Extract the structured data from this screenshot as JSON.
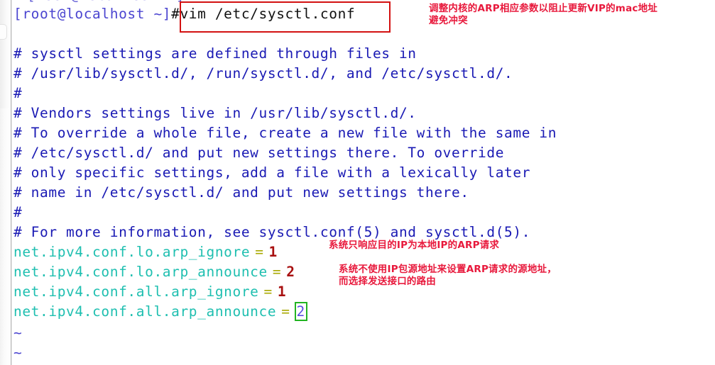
{
  "terminal": {
    "prompt": "[root@localhost ~]",
    "command": "#vim /etc/sysctl.conf",
    "top_partial_line": "[root@localhost ~]#",
    "comments": [
      "# sysctl settings are defined through files in",
      "# /usr/lib/sysctl.d/, /run/sysctl.d/, and /etc/sysctl.d/.",
      "#",
      "# Vendors settings live in /usr/lib/sysctl.d/.",
      "# To override a whole file, create a new file with the same in",
      "# /etc/sysctl.d/ and put new settings there. To override",
      "# only specific settings, add a file with a lexically later",
      "# name in /etc/sysctl.d/ and put new settings there.",
      "#",
      "# For more information, see sysctl.conf(5) and sysctl.d(5)."
    ],
    "settings": [
      {
        "key": "net.ipv4.conf.lo.arp_ignore",
        "eq": "=",
        "value": "1",
        "cursor": false
      },
      {
        "key": "net.ipv4.conf.lo.arp_announce",
        "eq": "=",
        "value": "2",
        "cursor": false
      },
      {
        "key": "net.ipv4.conf.all.arp_ignore",
        "eq": "=",
        "value": "1",
        "cursor": false
      },
      {
        "key": "net.ipv4.conf.all.arp_announce",
        "eq": "=",
        "value": "2",
        "cursor": true
      }
    ],
    "empty_markers": [
      "~",
      "~"
    ]
  },
  "annotations": {
    "top": "调整内核的ARP相应参数以阻止更新VIP的mac地址\n避免冲突",
    "arp_ignore": "系统只响应目的IP为本地IP的ARP请求",
    "arp_announce": "系统不使用IP包源地址来设置ARP请求的源地址，\n而选择发送接口的路由"
  },
  "colors": {
    "prompt": "#4b45d0",
    "command": "#111111",
    "comment": "#1a1ab4",
    "setting_key": "#1fbfb0",
    "equals": "#a8a800",
    "value": "#a81010",
    "annotation": "#e8193c",
    "highlight_box": "#d31111",
    "cursor_outline": "#22b422",
    "background": "#ffffff"
  }
}
